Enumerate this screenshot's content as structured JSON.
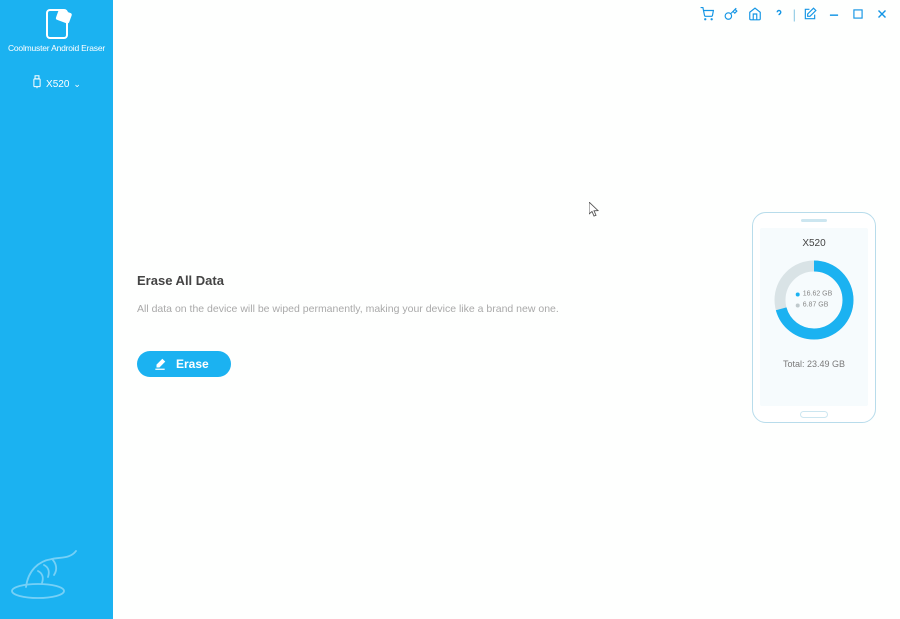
{
  "app": {
    "title": "Coolmuster Android Eraser"
  },
  "sidebar": {
    "device_label": "X520"
  },
  "content": {
    "title": "Erase All Data",
    "description": "All data on the device will be wiped permanently, making your device like a brand new one.",
    "erase_label": "Erase"
  },
  "device": {
    "name": "X520",
    "used_gb": "16.62 GB",
    "free_gb": "6.87 GB",
    "total_label": "Total: 23.49 GB",
    "used_pct": 70.7,
    "colors": {
      "used": "#1bb2f1",
      "free": "#d9e3e6"
    }
  },
  "colors": {
    "accent": "#1bb2f1"
  }
}
